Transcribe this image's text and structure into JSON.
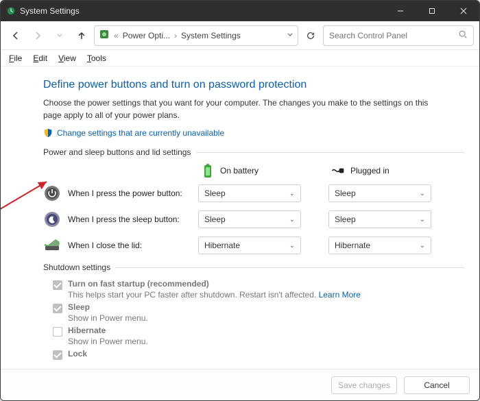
{
  "window": {
    "title": "System Settings"
  },
  "nav": {
    "breadcrumb": [
      "Power Opti...",
      "System Settings"
    ],
    "search_placeholder": "Search Control Panel"
  },
  "menubar": [
    "File",
    "Edit",
    "View",
    "Tools"
  ],
  "page": {
    "title": "Define power buttons and turn on password protection",
    "description": "Choose the power settings that you want for your computer. The changes you make to the settings on this page apply to all of your power plans.",
    "elevate_link": "Change settings that are currently unavailable"
  },
  "group1": {
    "header": "Power and sleep buttons and lid settings",
    "columns": {
      "battery": "On battery",
      "plugged": "Plugged in"
    },
    "rows": [
      {
        "label": "When I press the power button:",
        "battery": "Sleep",
        "plugged": "Sleep"
      },
      {
        "label": "When I press the sleep button:",
        "battery": "Sleep",
        "plugged": "Sleep"
      },
      {
        "label": "When I close the lid:",
        "battery": "Hibernate",
        "plugged": "Hibernate"
      }
    ]
  },
  "group2": {
    "header": "Shutdown settings",
    "items": [
      {
        "title": "Turn on fast startup (recommended)",
        "sub": "This helps start your PC faster after shutdown. Restart isn't affected.",
        "link": "Learn More",
        "checked": true
      },
      {
        "title": "Sleep",
        "sub": "Show in Power menu.",
        "checked": true
      },
      {
        "title": "Hibernate",
        "sub": "Show in Power menu.",
        "checked": false
      },
      {
        "title": "Lock",
        "sub": "",
        "checked": true
      }
    ]
  },
  "footer": {
    "save": "Save changes",
    "cancel": "Cancel"
  }
}
